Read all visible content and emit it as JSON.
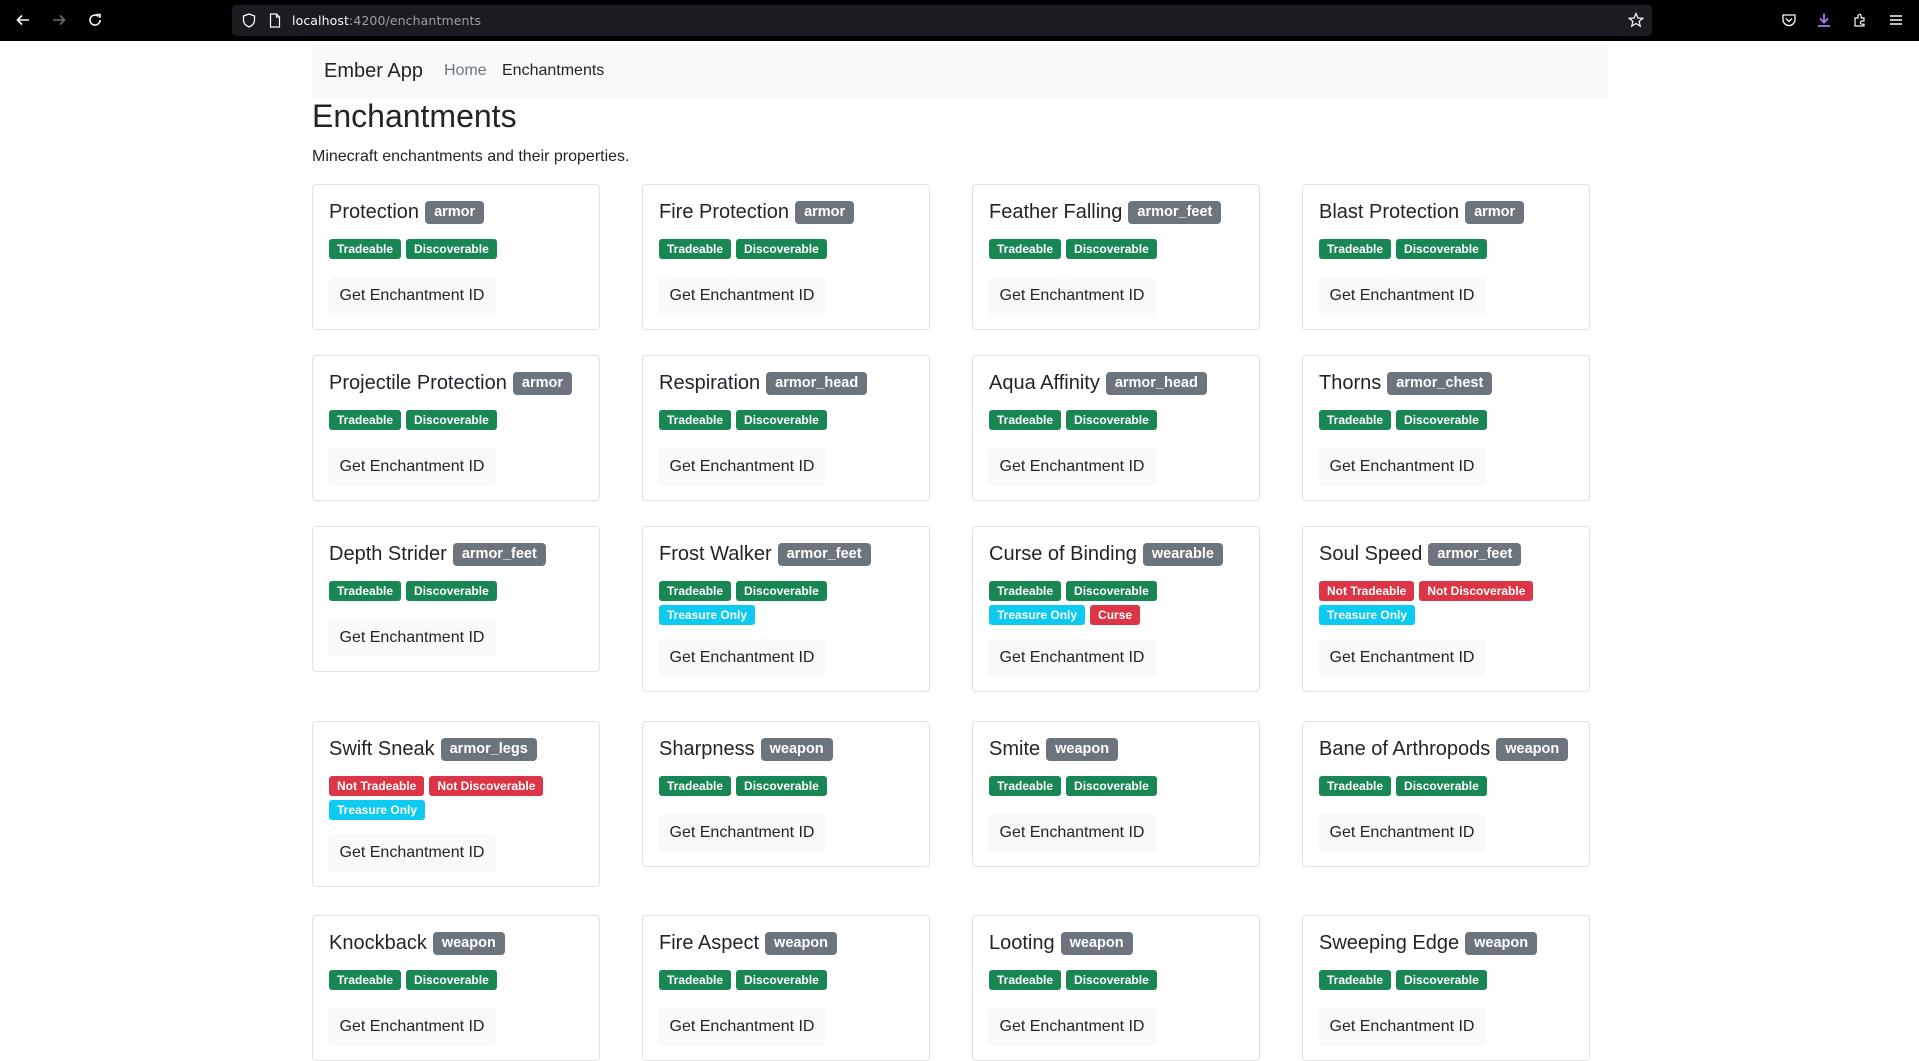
{
  "browser": {
    "url_host": "localhost",
    "url_rest": ":4200/enchantments"
  },
  "navbar": {
    "brand": "Ember App",
    "links": [
      {
        "label": "Home"
      },
      {
        "label": "Enchantments"
      }
    ]
  },
  "page": {
    "title": "Enchantments",
    "description": "Minecraft enchantments and their properties."
  },
  "button_label": "Get Enchantment ID",
  "badge_labels": {
    "tradeable": "Tradeable",
    "discoverable": "Discoverable",
    "not_tradeable": "Not Tradeable",
    "not_discoverable": "Not Discoverable",
    "treasure": "Treasure Only",
    "curse": "Curse"
  },
  "colors": {
    "positive": "#198754",
    "negative": "#dc3545",
    "treasure": "#0dcaf0",
    "slot": "#6c757d"
  },
  "enchantments": [
    {
      "name": "Protection",
      "slot": "armor",
      "tradeable": true,
      "discoverable": true,
      "treasure": false,
      "curse": false
    },
    {
      "name": "Fire Protection",
      "slot": "armor",
      "tradeable": true,
      "discoverable": true,
      "treasure": false,
      "curse": false
    },
    {
      "name": "Feather Falling",
      "slot": "armor_feet",
      "tradeable": true,
      "discoverable": true,
      "treasure": false,
      "curse": false
    },
    {
      "name": "Blast Protection",
      "slot": "armor",
      "tradeable": true,
      "discoverable": true,
      "treasure": false,
      "curse": false
    },
    {
      "name": "Projectile Protection",
      "slot": "armor",
      "tradeable": true,
      "discoverable": true,
      "treasure": false,
      "curse": false
    },
    {
      "name": "Respiration",
      "slot": "armor_head",
      "tradeable": true,
      "discoverable": true,
      "treasure": false,
      "curse": false
    },
    {
      "name": "Aqua Affinity",
      "slot": "armor_head",
      "tradeable": true,
      "discoverable": true,
      "treasure": false,
      "curse": false
    },
    {
      "name": "Thorns",
      "slot": "armor_chest",
      "tradeable": true,
      "discoverable": true,
      "treasure": false,
      "curse": false
    },
    {
      "name": "Depth Strider",
      "slot": "armor_feet",
      "tradeable": true,
      "discoverable": true,
      "treasure": false,
      "curse": false
    },
    {
      "name": "Frost Walker",
      "slot": "armor_feet",
      "tradeable": true,
      "discoverable": true,
      "treasure": true,
      "curse": false
    },
    {
      "name": "Curse of Binding",
      "slot": "wearable",
      "tradeable": true,
      "discoverable": true,
      "treasure": true,
      "curse": true
    },
    {
      "name": "Soul Speed",
      "slot": "armor_feet",
      "tradeable": false,
      "discoverable": false,
      "treasure": true,
      "curse": false
    },
    {
      "name": "Swift Sneak",
      "slot": "armor_legs",
      "tradeable": false,
      "discoverable": false,
      "treasure": true,
      "curse": false
    },
    {
      "name": "Sharpness",
      "slot": "weapon",
      "tradeable": true,
      "discoverable": true,
      "treasure": false,
      "curse": false
    },
    {
      "name": "Smite",
      "slot": "weapon",
      "tradeable": true,
      "discoverable": true,
      "treasure": false,
      "curse": false
    },
    {
      "name": "Bane of Arthropods",
      "slot": "weapon",
      "tradeable": true,
      "discoverable": true,
      "treasure": false,
      "curse": false
    },
    {
      "name": "Knockback",
      "slot": "weapon",
      "tradeable": true,
      "discoverable": true,
      "treasure": false,
      "curse": false
    },
    {
      "name": "Fire Aspect",
      "slot": "weapon",
      "tradeable": true,
      "discoverable": true,
      "treasure": false,
      "curse": false
    },
    {
      "name": "Looting",
      "slot": "weapon",
      "tradeable": true,
      "discoverable": true,
      "treasure": false,
      "curse": false
    },
    {
      "name": "Sweeping Edge",
      "slot": "weapon",
      "tradeable": true,
      "discoverable": true,
      "treasure": false,
      "curse": false
    }
  ]
}
